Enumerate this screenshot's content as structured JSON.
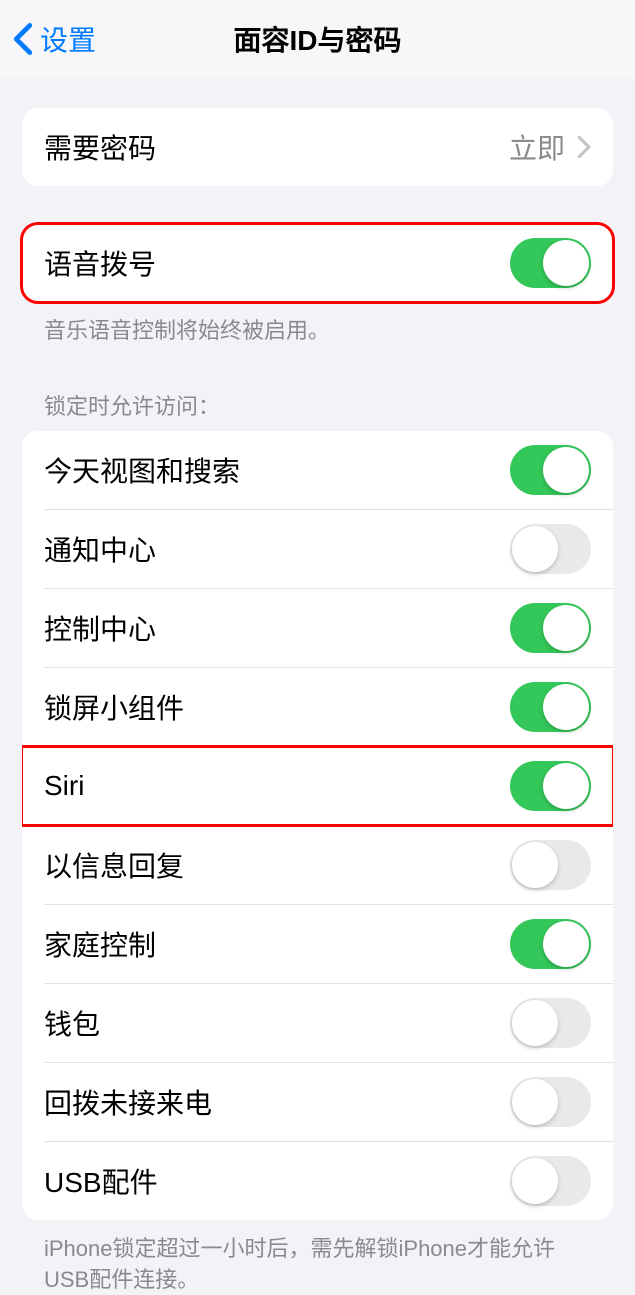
{
  "header": {
    "back_label": "设置",
    "title": "面容ID与密码"
  },
  "require_passcode": {
    "label": "需要密码",
    "value": "立即"
  },
  "voice_dial": {
    "label": "语音拨号",
    "enabled": true,
    "footer": "音乐语音控制将始终被启用。"
  },
  "lock_section": {
    "header": "锁定时允许访问：",
    "items": [
      {
        "label": "今天视图和搜索",
        "enabled": true
      },
      {
        "label": "通知中心",
        "enabled": false
      },
      {
        "label": "控制中心",
        "enabled": true
      },
      {
        "label": "锁屏小组件",
        "enabled": true
      },
      {
        "label": "Siri",
        "enabled": true,
        "highlight": true
      },
      {
        "label": "以信息回复",
        "enabled": false
      },
      {
        "label": "家庭控制",
        "enabled": true
      },
      {
        "label": "钱包",
        "enabled": false
      },
      {
        "label": "回拨未接来电",
        "enabled": false
      },
      {
        "label": "USB配件",
        "enabled": false
      }
    ],
    "footer": "iPhone锁定超过一小时后，需先解锁iPhone才能允许USB配件连接。"
  }
}
